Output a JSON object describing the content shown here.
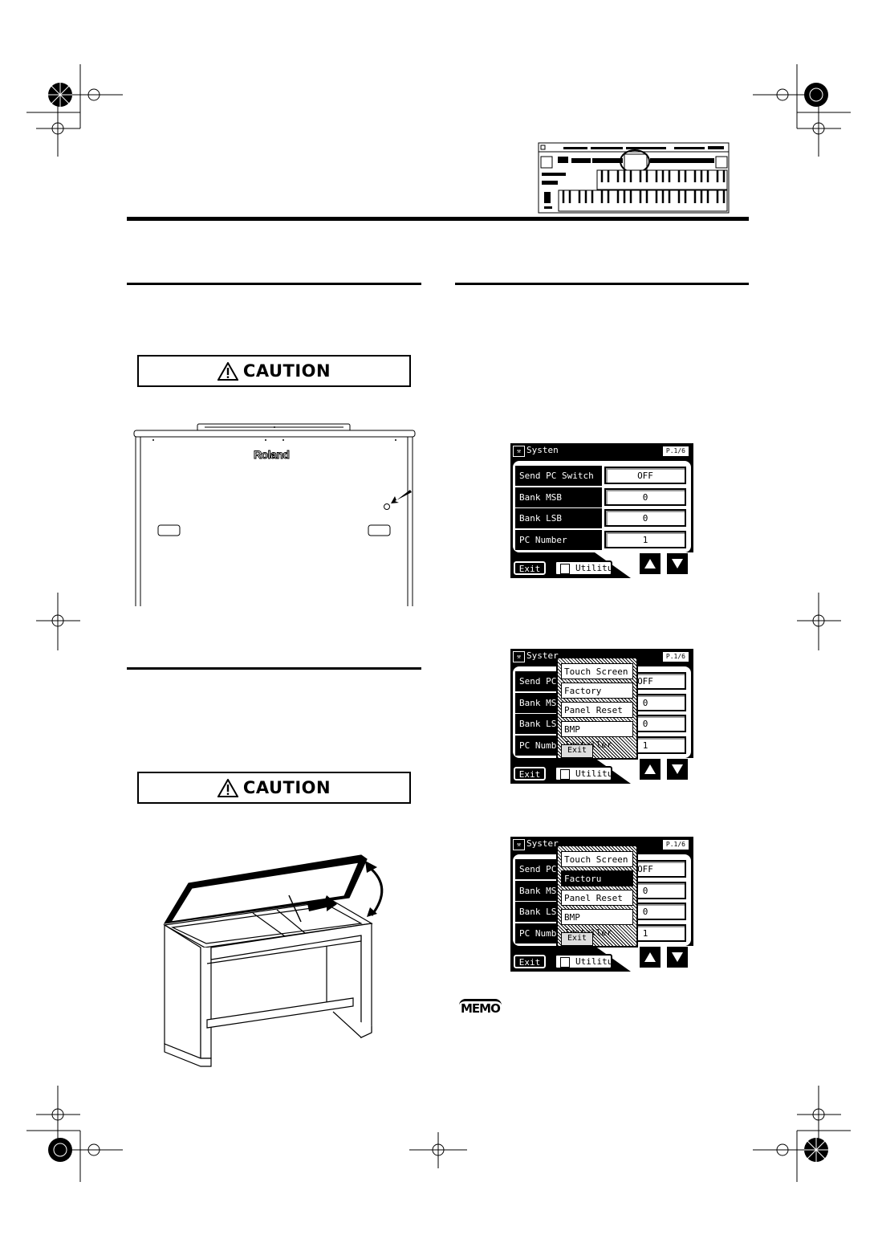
{
  "caution_1": {
    "label": "CAUTION",
    "icon": "warning-triangle-icon"
  },
  "caution_2": {
    "label": "CAUTION",
    "icon": "warning-triangle-icon"
  },
  "back_panel": {
    "brand_logo": "Roland"
  },
  "memo": {
    "label": "MEMO"
  },
  "screens": [
    {
      "title": "Systen",
      "page": "P.1/6",
      "rows": [
        {
          "label": "Send PC Switch",
          "value": "OFF"
        },
        {
          "label": "Bank MSB",
          "value": "0"
        },
        {
          "label": "Bank LSB",
          "value": "0"
        },
        {
          "label": "PC Number",
          "value": "1"
        }
      ],
      "exit_label": "Exit",
      "utility_label": "Utilitu",
      "popup": null
    },
    {
      "title": "Syster",
      "page": "P.1/6",
      "rows": [
        {
          "label": "Send PC",
          "value": "OFF"
        },
        {
          "label": "Bank MS",
          "value": "0"
        },
        {
          "label": "Bank LS",
          "value": "0"
        },
        {
          "label": "PC Numb",
          "value": "1"
        }
      ],
      "exit_label": "Exit",
      "utility_label": "Utilitu",
      "popup": {
        "items": [
          "Touch Screen",
          "Factory Reset",
          "Panel Reset",
          "BMP Installer"
        ],
        "selected": -1,
        "exit_label": "Exit"
      }
    },
    {
      "title": "Syster",
      "page": "P.1/6",
      "rows": [
        {
          "label": "Send PC",
          "value": "OFF"
        },
        {
          "label": "Bank MS",
          "value": "0"
        },
        {
          "label": "Bank LS",
          "value": "0"
        },
        {
          "label": "PC Numb",
          "value": "1"
        }
      ],
      "exit_label": "Exit",
      "utility_label": "Utilitu",
      "popup": {
        "items": [
          "Touch Screen",
          "Factoru Reset",
          "Panel Reset",
          "BMP Installer"
        ],
        "selected": 1,
        "exit_label": "Exit"
      }
    }
  ]
}
